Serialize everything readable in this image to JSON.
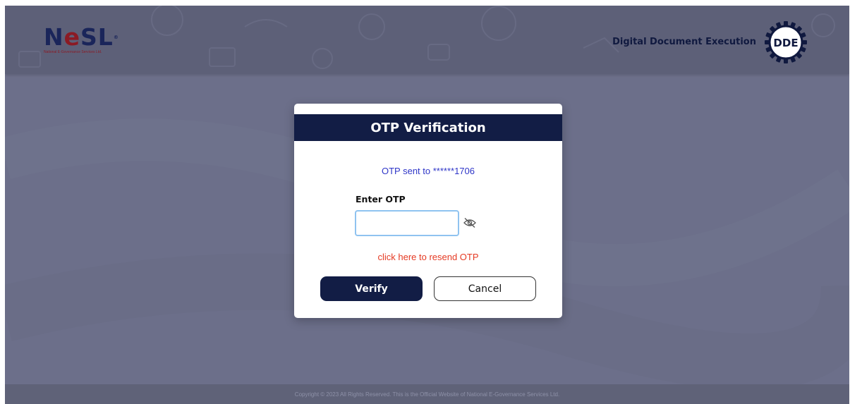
{
  "header": {
    "logo_text": "NeSL",
    "logo_subtext": "National E-Governance Services Ltd.",
    "title": "Digital Document Execution",
    "badge_text": "DDE"
  },
  "modal": {
    "title": "OTP Verification",
    "otp_sent_text": "OTP sent to ******1706",
    "enter_label": "Enter OTP",
    "input_value": "",
    "input_placeholder": "",
    "resend_link": "click here to resend OTP",
    "verify_label": "Verify",
    "cancel_label": "Cancel"
  },
  "footer": {
    "copyright": "Copyright © 2023 All Rights Reserved. This is the Official Website of National E-Governance Services Ltd."
  },
  "colors": {
    "brand_navy": "#121d45",
    "overlay": "#6c6f8a",
    "link_red": "#e53a23",
    "info_blue": "#2f36c8"
  },
  "icons": {
    "password_toggle": "eye-slash-icon",
    "badge": "gear-icon"
  }
}
